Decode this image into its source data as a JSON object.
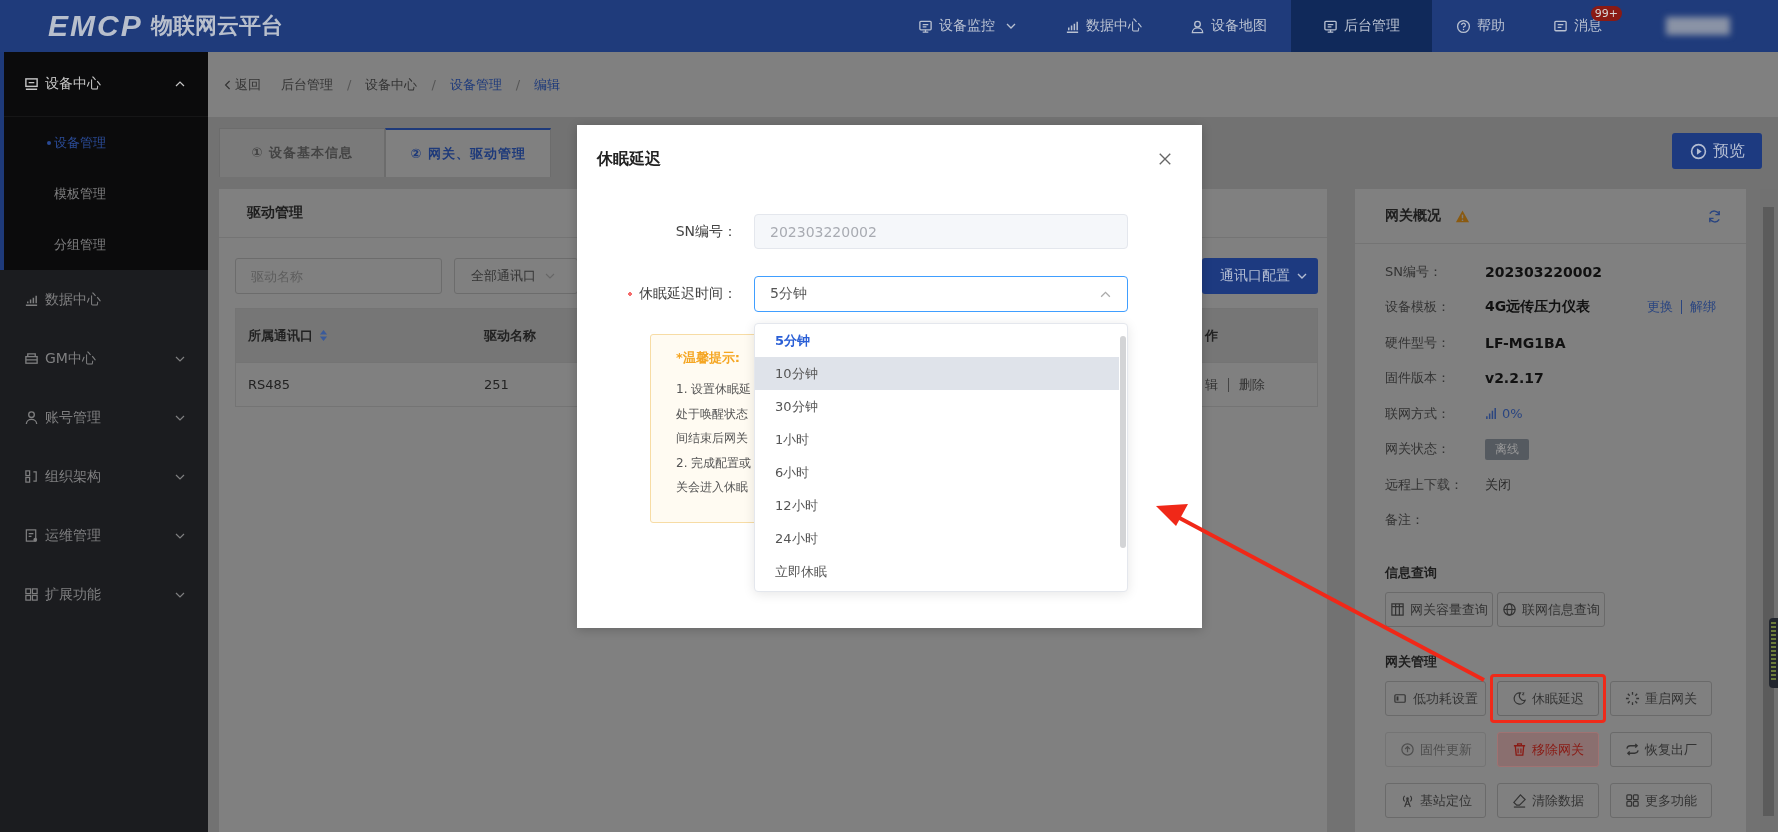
{
  "topbar": {
    "logo": "EMCP",
    "brand": "物联网云平台",
    "nav": [
      {
        "label": "设备监控",
        "kind": "menu",
        "selected": false
      },
      {
        "label": "数据中心",
        "kind": "link",
        "selected": false
      },
      {
        "label": "设备地图",
        "kind": "link",
        "selected": false
      },
      {
        "label": "后台管理",
        "kind": "link",
        "selected": true
      },
      {
        "label": "帮助",
        "kind": "link",
        "selected": false
      },
      {
        "label": "消息",
        "kind": "link",
        "selected": false,
        "badge": "99+"
      }
    ]
  },
  "sidebar": {
    "items": [
      {
        "label": "设备中心",
        "kind": "group",
        "expanded": true,
        "children": [
          {
            "label": "设备管理",
            "selected": true
          },
          {
            "label": "模板管理",
            "selected": false
          },
          {
            "label": "分组管理",
            "selected": false
          }
        ]
      },
      {
        "label": "数据中心",
        "kind": "link"
      },
      {
        "label": "GM中心",
        "kind": "group",
        "expanded": false
      },
      {
        "label": "账号管理",
        "kind": "group",
        "expanded": false
      },
      {
        "label": "组织架构",
        "kind": "group",
        "expanded": false
      },
      {
        "label": "运维管理",
        "kind": "group",
        "expanded": false
      },
      {
        "label": "扩展功能",
        "kind": "group",
        "expanded": false
      }
    ]
  },
  "breadcrumb": {
    "back": "返回",
    "separator": "/",
    "items": [
      {
        "label": "后台管理",
        "highlighted": false
      },
      {
        "label": "设备中心",
        "highlighted": false
      },
      {
        "label": "设备管理",
        "highlighted": true
      },
      {
        "label": "编辑",
        "highlighted": true
      }
    ]
  },
  "tabs": [
    {
      "label": "① 设备基本信息",
      "selected": false
    },
    {
      "label": "② 网关、驱动管理",
      "selected": true
    }
  ],
  "preview_button": "预览",
  "drivers": {
    "title": "驱动管理",
    "search_placeholder": "驱动名称",
    "port_filter": "全部通讯口",
    "config_button": "通讯口配置",
    "columns": [
      {
        "label": "所属通讯口",
        "sortable": true
      },
      {
        "label": "驱动名称",
        "sortable": false
      },
      {
        "label": "作",
        "sortable": false
      }
    ],
    "rows": [
      {
        "cells": [
          "RS485",
          "251"
        ],
        "actions": [
          "辑",
          "删除"
        ]
      }
    ]
  },
  "gateway": {
    "title": "网关概况",
    "fields": [
      {
        "label": "SN编号：",
        "value": "202303220002",
        "kind": "strong"
      },
      {
        "label": "设备模板：",
        "value": "4G远传压力仪表",
        "kind": "strong",
        "links": [
          "更换",
          "解绑"
        ]
      },
      {
        "label": "硬件型号：",
        "value": "LF-MG1BA",
        "kind": "strong"
      },
      {
        "label": "固件版本：",
        "value": "v2.2.17",
        "kind": "strong"
      },
      {
        "label": "联网方式：",
        "value": "0%",
        "kind": "signal"
      },
      {
        "label": "网关状态：",
        "value": "离线",
        "kind": "tag"
      },
      {
        "label": "远程上下载：",
        "value": "关闭",
        "kind": "plain"
      },
      {
        "label": "备注："
      }
    ],
    "sections": [
      {
        "title": "信息查询",
        "buttons": [
          {
            "label": "网关容量查询",
            "kind": "default",
            "highlighted": false
          },
          {
            "label": "联网信息查询",
            "kind": "default",
            "highlighted": false
          }
        ]
      },
      {
        "title": "网关管理",
        "buttons": [
          {
            "label": "低功耗设置",
            "kind": "default",
            "highlighted": false
          },
          {
            "label": "休眠延迟",
            "kind": "default",
            "highlighted": true
          },
          {
            "label": "重启网关",
            "kind": "default",
            "highlighted": false
          },
          {
            "label": "固件更新",
            "kind": "disabled",
            "highlighted": false
          },
          {
            "label": "移除网关",
            "kind": "danger",
            "highlighted": false
          },
          {
            "label": "恢复出厂",
            "kind": "default",
            "highlighted": false
          },
          {
            "label": "基站定位",
            "kind": "default",
            "highlighted": false
          },
          {
            "label": "清除数据",
            "kind": "default",
            "highlighted": false
          },
          {
            "label": "更多功能",
            "kind": "default",
            "highlighted": false
          }
        ]
      }
    ]
  },
  "dialog": {
    "title": "休眠延迟",
    "sn_label": "SN编号：",
    "sn_value": "202303220002",
    "delay_label": "休眠延迟时间：",
    "required": true,
    "delay_value": "5分钟",
    "tip_title": "*温馨提示:",
    "tip_lines": [
      "1. 设置休眠延",
      "处于唤醒状态",
      "间结束后网关",
      "2. 完成配置或",
      "关会进入休眠"
    ],
    "options": [
      {
        "label": "5分钟",
        "selected": true,
        "hovered": false
      },
      {
        "label": "10分钟",
        "selected": false,
        "hovered": true
      },
      {
        "label": "30分钟",
        "selected": false,
        "hovered": false
      },
      {
        "label": "1小时",
        "selected": false,
        "hovered": false
      },
      {
        "label": "6小时",
        "selected": false,
        "hovered": false
      },
      {
        "label": "12小时",
        "selected": false,
        "hovered": false
      },
      {
        "label": "24小时",
        "selected": false,
        "hovered": false
      },
      {
        "label": "立即休眠",
        "selected": false,
        "hovered": false
      }
    ]
  }
}
